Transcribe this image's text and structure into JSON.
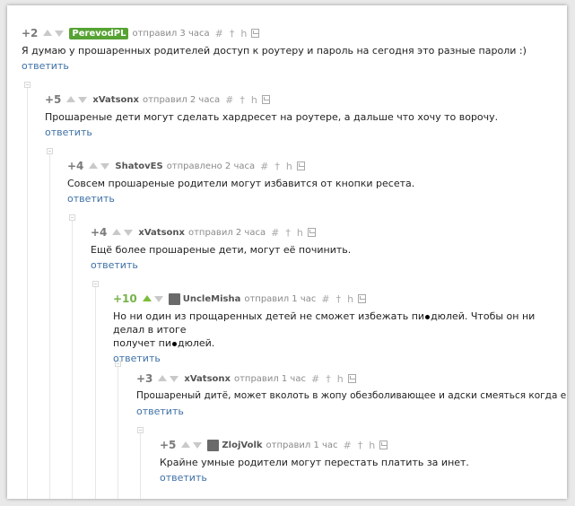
{
  "tools": {
    "link": "#",
    "pin": "†",
    "tree": "h"
  },
  "colors": {
    "link": "#3f71a6",
    "score_positive": "#7a7a7a",
    "badge": "#56a334"
  },
  "comments": [
    {
      "score": "+2",
      "author": "PerevodPL",
      "posted": "отправил 3 часа",
      "text": "Я думаю у прошаренных родителей доступ к роутеру и пароль на сегодня это разные пароли :)",
      "reply": "ответить"
    },
    {
      "score": "+5",
      "author": "xVatsonx",
      "posted": "отправил 2 часа",
      "text": "Прошареные дети могут сделать хардресет на роутере, а дальше что хочу то ворочу.",
      "reply": "ответить"
    },
    {
      "score": "+4",
      "author": "ShatovES",
      "posted": "отправлено 2 часа",
      "text": "Совсем прошареные родители могут избавится от кнопки ресета.",
      "reply": "ответить"
    },
    {
      "score": "+4",
      "author": "xVatsonx",
      "posted": "отправил 2 часа",
      "text": "Ещё более прошареные дети, могут её починить.",
      "reply": "ответить"
    },
    {
      "score": "+10",
      "author": "UncleMisha",
      "posted": "отправил 1 час",
      "text_a": "Но ни один из прощаренных детей не сможет избежать пи",
      "text_b": "дюлей. Чтобы он ни делал в итоге",
      "text_c": "получет пи",
      "text_d": "дюлей.",
      "reply": "ответить"
    },
    {
      "score": "+3",
      "author": "xVatsonx",
      "posted": "отправил 1 час",
      "text": "Прошареный дитё, может вколоть в жопу обезболивающее и адски смеяться когда его лупят.",
      "reply": "ответить"
    },
    {
      "score": "+5",
      "author": "ZlojVolk",
      "posted": "отправил 1 час",
      "text": "Крайне умные родители могут перестать платить за инет.",
      "reply": "ответить"
    }
  ]
}
